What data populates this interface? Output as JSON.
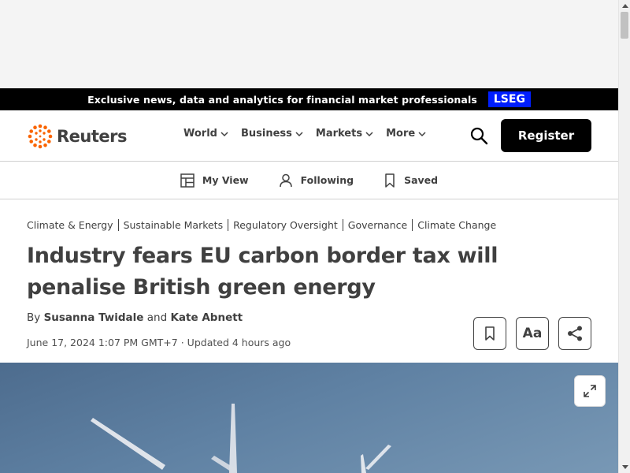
{
  "promo": {
    "text": "Exclusive news, data and analytics for financial market professionals",
    "badge": "LSEG"
  },
  "header": {
    "logo_text": "Reuters",
    "nav": [
      {
        "label": "World"
      },
      {
        "label": "Business"
      },
      {
        "label": "Markets"
      },
      {
        "label": "More"
      }
    ],
    "register_label": "Register"
  },
  "subnav": {
    "my_view": "My View",
    "following": "Following",
    "saved": "Saved"
  },
  "article": {
    "tags": [
      "Climate & Energy",
      "Sustainable Markets",
      "Regulatory Oversight",
      "Governance",
      "Climate Change"
    ],
    "headline": "Industry fears EU carbon border tax will penalise British green energy",
    "byline": {
      "prefix": "By",
      "author1": "Susanna Twidale",
      "conjunction": "and",
      "author2": "Kate Abnett"
    },
    "date": "June 17, 2024 1:07 PM GMT+7",
    "separator": "·",
    "updated": "Updated 4 hours ago",
    "font_button_label": "Aa"
  },
  "colors": {
    "promo_bg": "#000000",
    "lseg_blue": "#001eff",
    "logo_orange": "#fa6400",
    "text": "#404040",
    "register_bg": "#000000"
  }
}
